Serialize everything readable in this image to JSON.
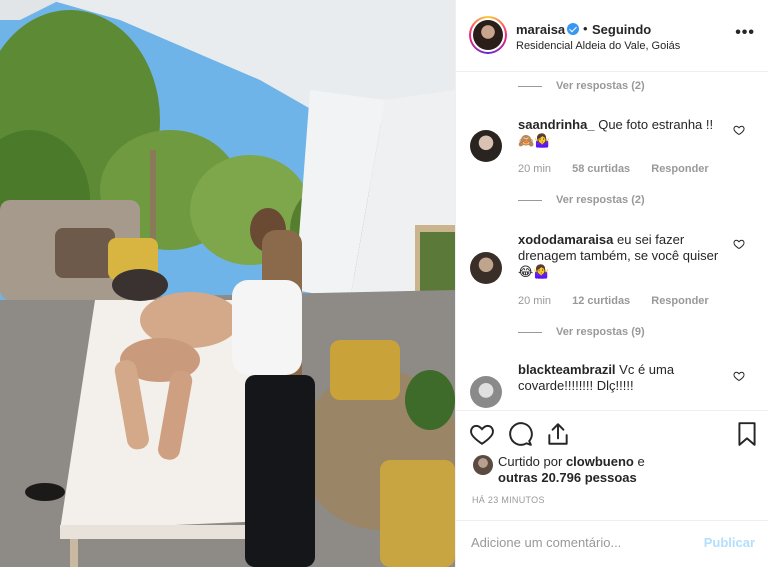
{
  "post": {
    "username": "maraisa",
    "dot": "•",
    "follow_state": "Seguindo",
    "location": "Residencial Aldeia do Vale, Goiás",
    "more": "•••"
  },
  "comments": {
    "replies_1": "Ver respostas (2)",
    "c1_user": "saandrinha_",
    "c1_text": "Que foto estranha !! 🙈🤷‍♀️",
    "c1_time": "20 min",
    "c1_likes": "58 curtidas",
    "c1_reply": "Responder",
    "replies_2": "Ver respostas (2)",
    "c2_user": "xododamaraisa",
    "c2_text": "eu sei fazer drenagem também, se você quiser 😂🤷‍♀️",
    "c2_time": "20 min",
    "c2_likes": "12 curtidas",
    "c2_reply": "Responder",
    "replies_3": "Ver respostas (9)",
    "c3_user": "blackteambrazil",
    "c3_text": "Vc é uma covarde!!!!!!!! Dlç!!!!!"
  },
  "actions": {
    "liked_by_prefix": "Curtido por",
    "liked_by_user": "clowbueno",
    "liked_by_and": "e",
    "others_count": "outras 20.796 pessoas",
    "timestamp": "HÁ 23 MINUTOS"
  },
  "add_comment": {
    "placeholder": "Adicione um comentário...",
    "post_label": "Publicar"
  },
  "icons": {
    "verified": "verified-badge-icon",
    "heart": "heart-icon",
    "comment": "comment-icon",
    "share": "share-icon",
    "bookmark": "bookmark-icon",
    "more": "more-options-icon"
  },
  "colors": {
    "verified_blue": "#3897f0",
    "post_button_disabled": "#b2dffc",
    "muted_text": "#999999"
  }
}
